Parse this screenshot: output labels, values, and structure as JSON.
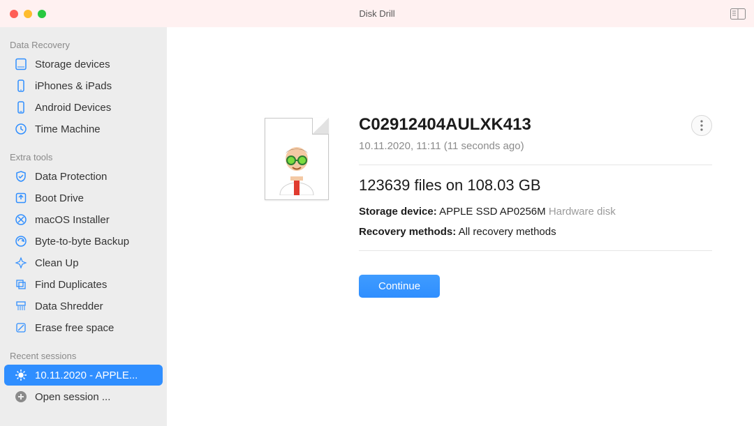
{
  "titlebar": {
    "title": "Disk Drill"
  },
  "sidebar": {
    "section1_header": "Data Recovery",
    "items1": [
      {
        "label": "Storage devices"
      },
      {
        "label": "iPhones & iPads"
      },
      {
        "label": "Android Devices"
      },
      {
        "label": "Time Machine"
      }
    ],
    "section2_header": "Extra tools",
    "items2": [
      {
        "label": "Data Protection"
      },
      {
        "label": "Boot Drive"
      },
      {
        "label": "macOS Installer"
      },
      {
        "label": "Byte-to-byte Backup"
      },
      {
        "label": "Clean Up"
      },
      {
        "label": "Find Duplicates"
      },
      {
        "label": "Data Shredder"
      },
      {
        "label": "Erase free space"
      }
    ],
    "section3_header": "Recent sessions",
    "recent_selected_label": "10.11.2020 - APPLE...",
    "open_session_label": "Open session ..."
  },
  "main": {
    "session_title": "C02912404AULXK413",
    "session_subtitle": "10.11.2020, 11:11 (11 seconds ago)",
    "files_line": "123639 files on 108.03 GB",
    "storage_label": "Storage device:",
    "storage_value": "APPLE SSD AP0256M",
    "storage_tail": "Hardware disk",
    "methods_label": "Recovery methods:",
    "methods_value": "All recovery methods",
    "continue_label": "Continue"
  }
}
